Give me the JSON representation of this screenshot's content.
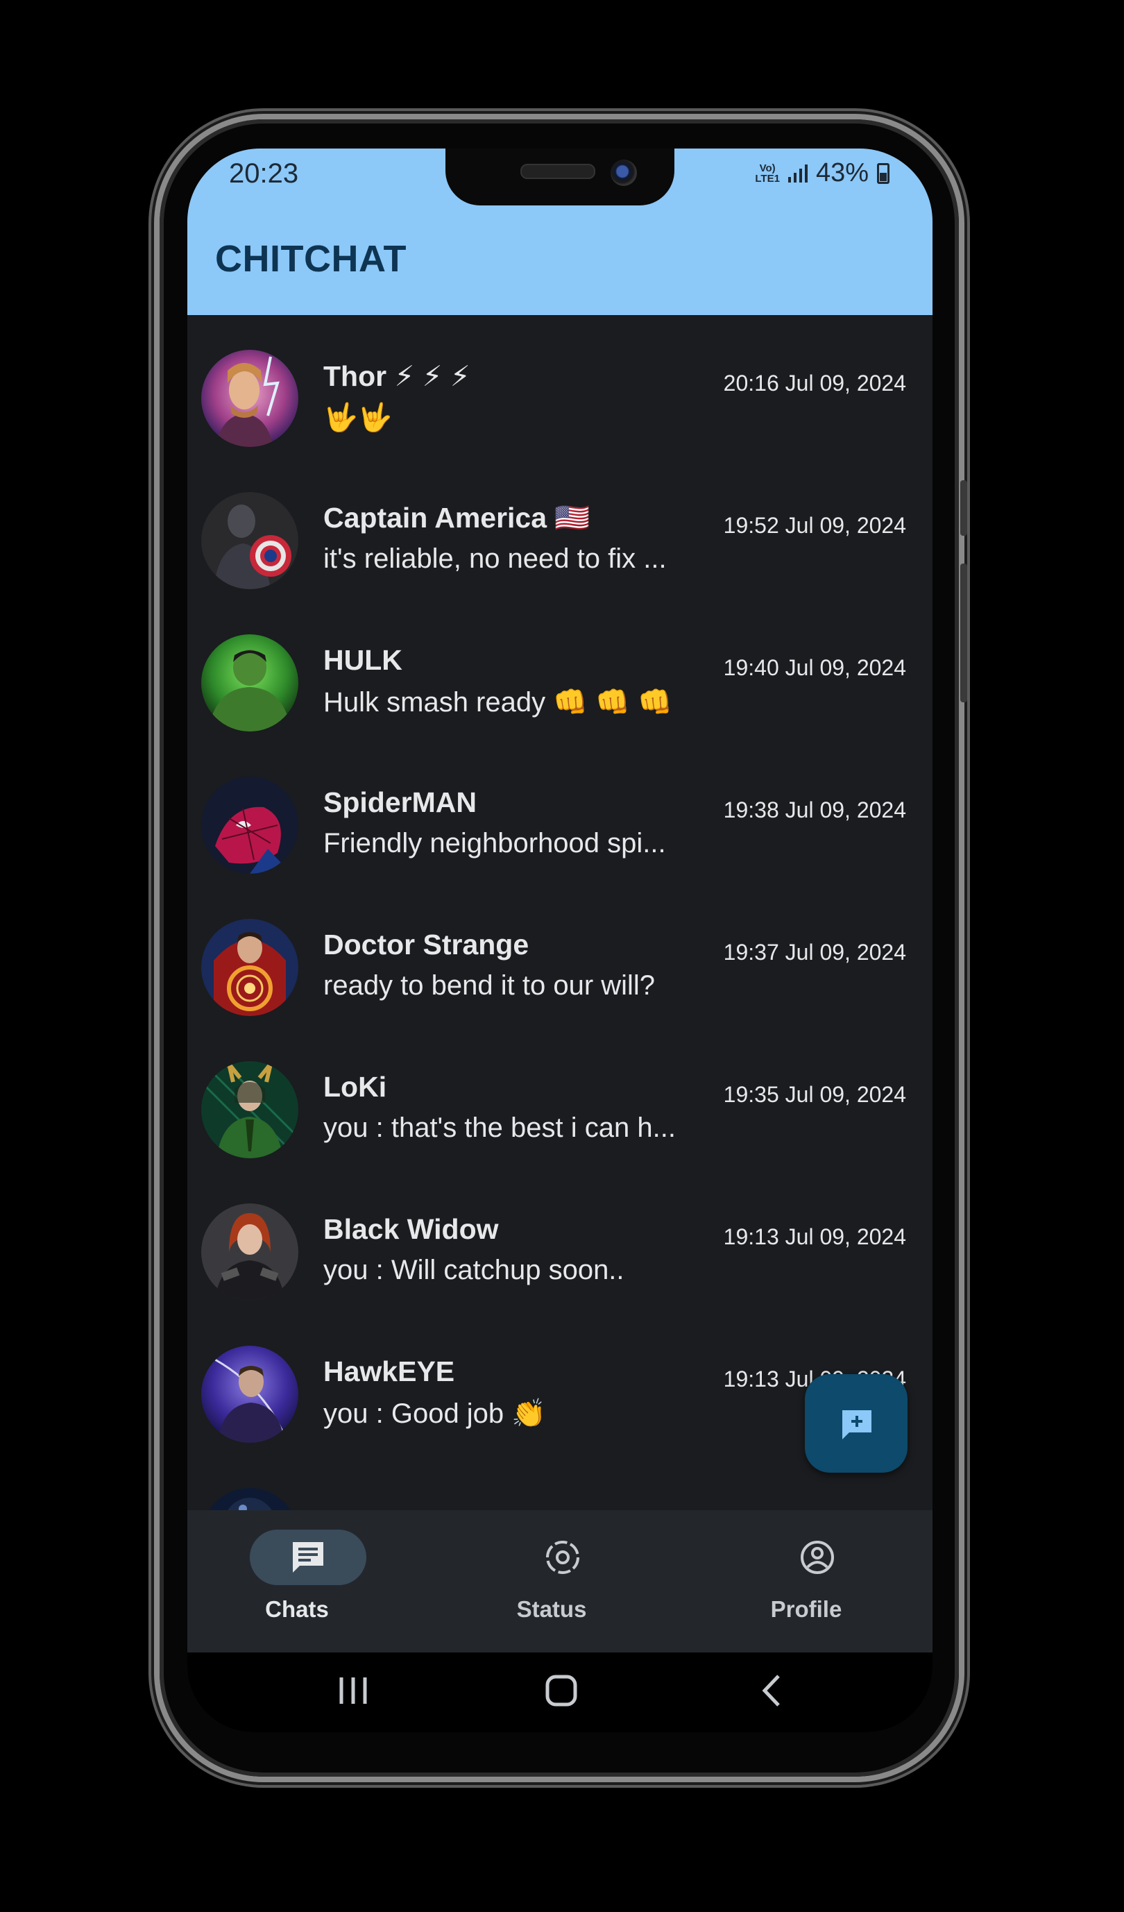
{
  "status_bar": {
    "time": "20:23",
    "network": "Vo) LTE1",
    "battery": "43%"
  },
  "app": {
    "title": "CHITCHAT",
    "accent_color": "#8cc8f8",
    "background_color": "#1a1c1f"
  },
  "chats": [
    {
      "name": "Thor ⚡ ⚡ ⚡",
      "message": "🤟🤟",
      "time": "20:16 Jul 09, 2024",
      "avatar": "thor-avatar"
    },
    {
      "name": "Captain America 🇺🇸",
      "message": "it's reliable, no need to fix ...",
      "time": "19:52 Jul 09, 2024",
      "avatar": "captain-america-avatar"
    },
    {
      "name": "HULK",
      "message": "Hulk smash ready 👊 👊 👊",
      "time": "19:40 Jul 09, 2024",
      "avatar": "hulk-avatar"
    },
    {
      "name": "SpiderMAN",
      "message": "Friendly neighborhood spi...",
      "time": "19:38 Jul 09, 2024",
      "avatar": "spiderman-avatar"
    },
    {
      "name": "Doctor Strange",
      "message": "ready to bend it to our will?",
      "time": "19:37 Jul 09, 2024",
      "avatar": "doctor-strange-avatar"
    },
    {
      "name": "LoKi",
      "message": "you : that's the best i can h...",
      "time": "19:35 Jul 09, 2024",
      "avatar": "loki-avatar"
    },
    {
      "name": "Black Widow",
      "message": "you : Will catchup soon..",
      "time": "19:13 Jul 09, 2024",
      "avatar": "black-widow-avatar"
    },
    {
      "name": "HawkEYE",
      "message": "you : Good job 👏",
      "time": "19:13 Jul 09, 2024",
      "avatar": "hawkeye-avatar"
    }
  ],
  "fab": {
    "icon": "new-chat-icon"
  },
  "bottom_nav": [
    {
      "label": "Chats",
      "icon": "chat-icon",
      "active": true
    },
    {
      "label": "Status",
      "icon": "status-icon",
      "active": false
    },
    {
      "label": "Profile",
      "icon": "profile-icon",
      "active": false
    }
  ],
  "system_nav": [
    "recents-icon",
    "home-icon",
    "back-icon"
  ]
}
